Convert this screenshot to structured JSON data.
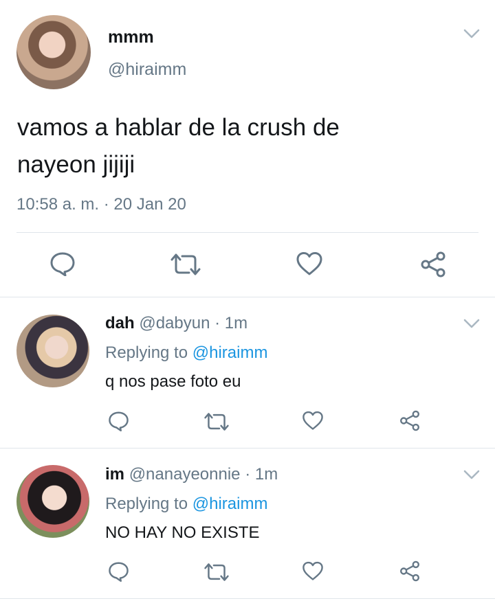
{
  "main_tweet": {
    "author_name": "mmm",
    "handle": "@hiraimm",
    "text_line1": "vamos a hablar de la crush de",
    "text_line2": "nayeon jijiji",
    "timestamp": "10:58 a. m. · 20 Jan 20"
  },
  "replies": [
    {
      "author_name": "dah",
      "handle": "@dabyun",
      "time": "· 1m",
      "replying_prefix": "Replying to",
      "replying_handle": "@hiraimm",
      "text": "q nos pase foto eu"
    },
    {
      "author_name": "im",
      "handle": "@nanayeonnie",
      "time": "· 1m",
      "replying_prefix": "Replying to",
      "replying_handle": "@hiraimm",
      "text": "NO HAY NO EXISTE"
    }
  ],
  "icons": {
    "reply": "reply-icon",
    "retweet": "retweet-icon",
    "like": "heart-icon",
    "share": "share-icon",
    "menu": "chevron-down-icon"
  },
  "colors": {
    "text": "#14171a",
    "secondary": "#657786",
    "link": "#1b95e0",
    "divider": "#dfe5ea"
  }
}
